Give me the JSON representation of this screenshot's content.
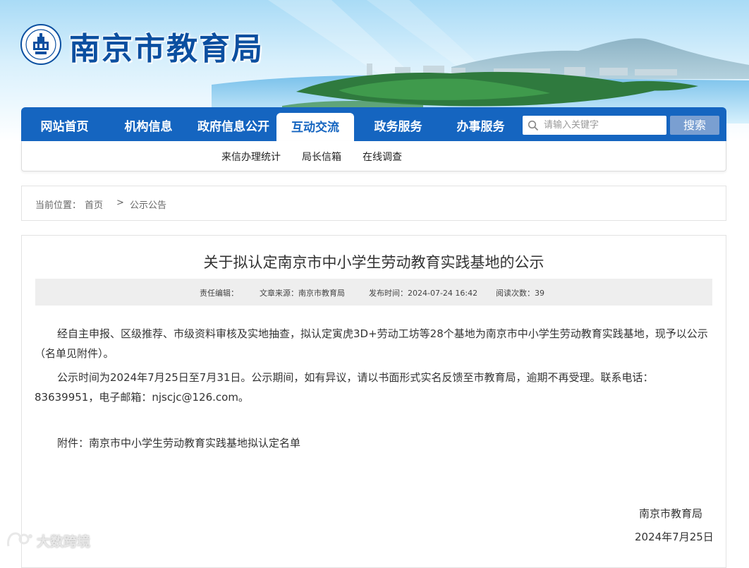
{
  "header": {
    "site_title": "南京市教育局",
    "logo_text": "CHINA NANJING EDUCATION"
  },
  "nav": {
    "items": [
      {
        "label": "网站首页"
      },
      {
        "label": "机构信息"
      },
      {
        "label": "政府信息公开"
      },
      {
        "label": "互动交流",
        "active": true
      },
      {
        "label": "政务服务"
      },
      {
        "label": "办事服务"
      }
    ],
    "search": {
      "placeholder": "请输入关键字",
      "button": "搜索"
    },
    "sub_items": [
      {
        "label": "来信办理统计"
      },
      {
        "label": "局长信箱"
      },
      {
        "label": "在线调查"
      }
    ]
  },
  "breadcrumb": {
    "prefix": "当前位置：",
    "home": "首页",
    "separator": ">",
    "current": "公示公告"
  },
  "article": {
    "title": "关于拟认定南京市中小学生劳动教育实践基地的公示",
    "meta": {
      "editor": "责任编辑：",
      "source": "文章来源：南京市教育局",
      "published": "发布时间：2024-07-24 16:42",
      "views": "阅读次数：39"
    },
    "paragraphs": [
      "经自主申报、区级推荐、市级资料审核及实地抽查，拟认定寅虎3D+劳动工坊等28个基地为南京市中小学生劳动教育实践基地，现予以公示（名单见附件）。",
      "公示时间为2024年7月25日至7月31日。公示期间，如有异议，请以书面形式实名反馈至市教育局，逾期不再受理。联系电话：83639951，电子邮箱：njscjc@126.com。"
    ],
    "attachment_prefix": "附件：",
    "attachment_name": "南京市中小学生劳动教育实践基地拟认定名单",
    "signature_org": "南京市教育局",
    "signature_date": "2024年7月25日"
  },
  "watermark": {
    "text": "大数跨境"
  },
  "colors": {
    "nav_blue": "#1565c0",
    "title_blue": "#0b4fa0",
    "search_button": "#7a9fd1"
  }
}
